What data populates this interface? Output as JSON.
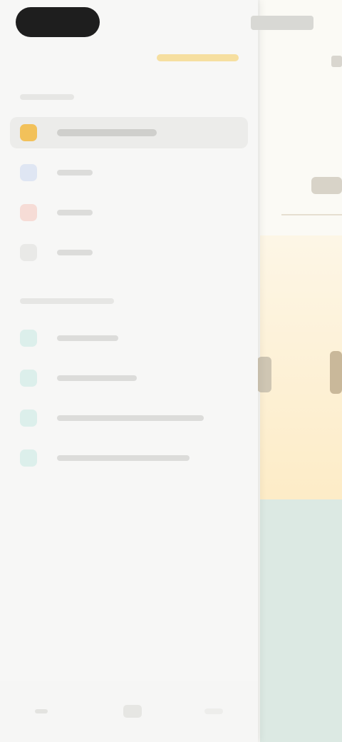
{
  "drawer": {
    "section_one_title": "",
    "section_two_title": "",
    "items": [
      {
        "label": "",
        "icon": "sun-icon",
        "color": "#f2c15a",
        "active": true
      },
      {
        "label": "",
        "icon": "calendar-icon",
        "color": "#8aa6d8",
        "active": false
      },
      {
        "label": "",
        "icon": "flag-icon",
        "color": "#e59a8c",
        "active": false
      },
      {
        "label": "",
        "icon": "check-icon",
        "color": "#b5b5b2",
        "active": false
      }
    ],
    "lists": [
      {
        "label": "",
        "icon": "list-icon",
        "color": "#8ecfc6"
      },
      {
        "label": "",
        "icon": "list-icon",
        "color": "#8ecfc6"
      },
      {
        "label": "",
        "icon": "list-icon",
        "color": "#8ecfc6"
      },
      {
        "label": "",
        "icon": "list-icon",
        "color": "#8ecfc6"
      }
    ]
  },
  "bottom_bar": {
    "tabs": [
      {
        "icon": "home-icon"
      },
      {
        "icon": "grid-icon"
      },
      {
        "icon": "plus-icon"
      }
    ]
  },
  "colors": {
    "accent": "#f2c15a",
    "drawer_bg": "#f7f7f6",
    "content_warm": "#fdecc7",
    "content_mint": "#dce9e3"
  }
}
